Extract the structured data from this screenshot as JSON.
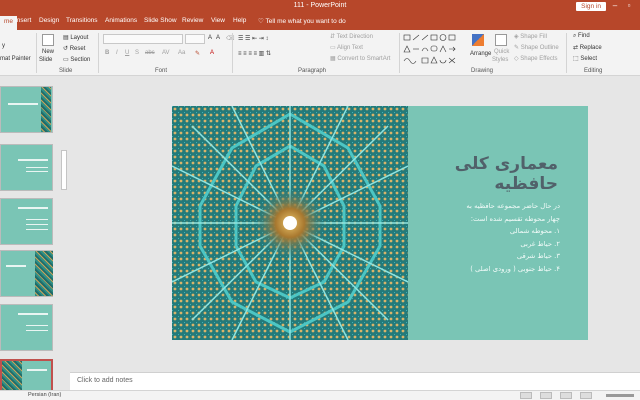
{
  "titlebar": {
    "title": "111  -  PowerPoint",
    "signin": "Sign in"
  },
  "tabs": [
    {
      "label": "me",
      "active": true
    },
    {
      "label": "Insert"
    },
    {
      "label": "Design"
    },
    {
      "label": "Transitions"
    },
    {
      "label": "Animations"
    },
    {
      "label": "Slide Show"
    },
    {
      "label": "Review"
    },
    {
      "label": "View"
    },
    {
      "label": "Help"
    }
  ],
  "tell_me": "Tell me what you want to do",
  "ribbon": {
    "clipboard": {
      "format_painter": "mat Painter"
    },
    "slides": {
      "new_slide": "New",
      "new_slide2": "Slide",
      "layout": "Layout",
      "reset": "Reset",
      "section": "Section",
      "label": "Slide"
    },
    "font": {
      "label": "Font"
    },
    "paragraph": {
      "text_direction": "Text Direction",
      "align_text": "Align Text",
      "convert_smartart": "Convert to SmartArt",
      "label": "Paragraph"
    },
    "drawing": {
      "arrange": "Arrange",
      "quick_styles": "Quick",
      "quick_styles2": "Styles",
      "shape_fill": "Shape Fill",
      "shape_outline": "Shape Outline",
      "shape_effects": "Shape Effects",
      "label": "Drawing"
    },
    "editing": {
      "find": "Find",
      "replace": "Replace",
      "select": "Select",
      "label": "Editing"
    }
  },
  "slide": {
    "title": "معماری کلی حافظیه",
    "body": [
      "در حال حاضر مجموعه حافظیه به",
      "چهار محوطه تقسیم شده است:",
      "۱. محوطه شمالی",
      "۲. حیاط غربی",
      "۳. حیاط شرقی",
      "۴. حیاط جنوبی ( ورودی اصلی )"
    ],
    "colors": {
      "background": "#7ac5b5",
      "title": "#51616a"
    }
  },
  "notes": {
    "placeholder": "Click to add notes"
  },
  "status": {
    "language": "Persian (Iran)"
  }
}
